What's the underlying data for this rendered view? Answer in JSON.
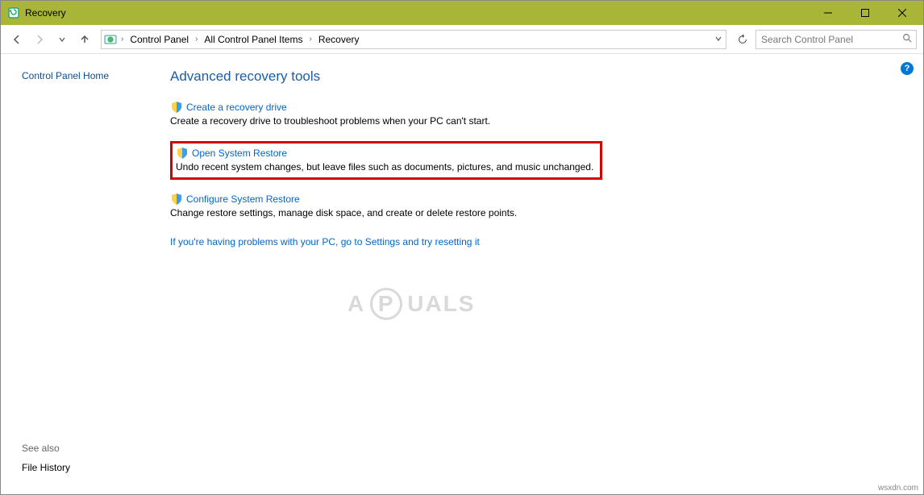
{
  "window": {
    "title": "Recovery"
  },
  "breadcrumb": {
    "items": [
      "Control Panel",
      "All Control Panel Items",
      "Recovery"
    ]
  },
  "search": {
    "placeholder": "Search Control Panel"
  },
  "sidebar": {
    "home": "Control Panel Home",
    "see_also_heading": "See also",
    "see_also_link": "File History"
  },
  "main": {
    "heading": "Advanced recovery tools",
    "tools": [
      {
        "link": "Create a recovery drive",
        "desc": "Create a recovery drive to troubleshoot problems when your PC can't start."
      },
      {
        "link": "Open System Restore",
        "desc": "Undo recent system changes, but leave files such as documents, pictures, and music unchanged."
      },
      {
        "link": "Configure System Restore",
        "desc": "Change restore settings, manage disk space, and create or delete restore points."
      }
    ],
    "footer_link": "If you're having problems with your PC, go to Settings and try resetting it"
  },
  "help": "?",
  "watermark": {
    "left": "A",
    "circle": "P",
    "right": "UALS"
  },
  "attribution": "wsxdn.com"
}
